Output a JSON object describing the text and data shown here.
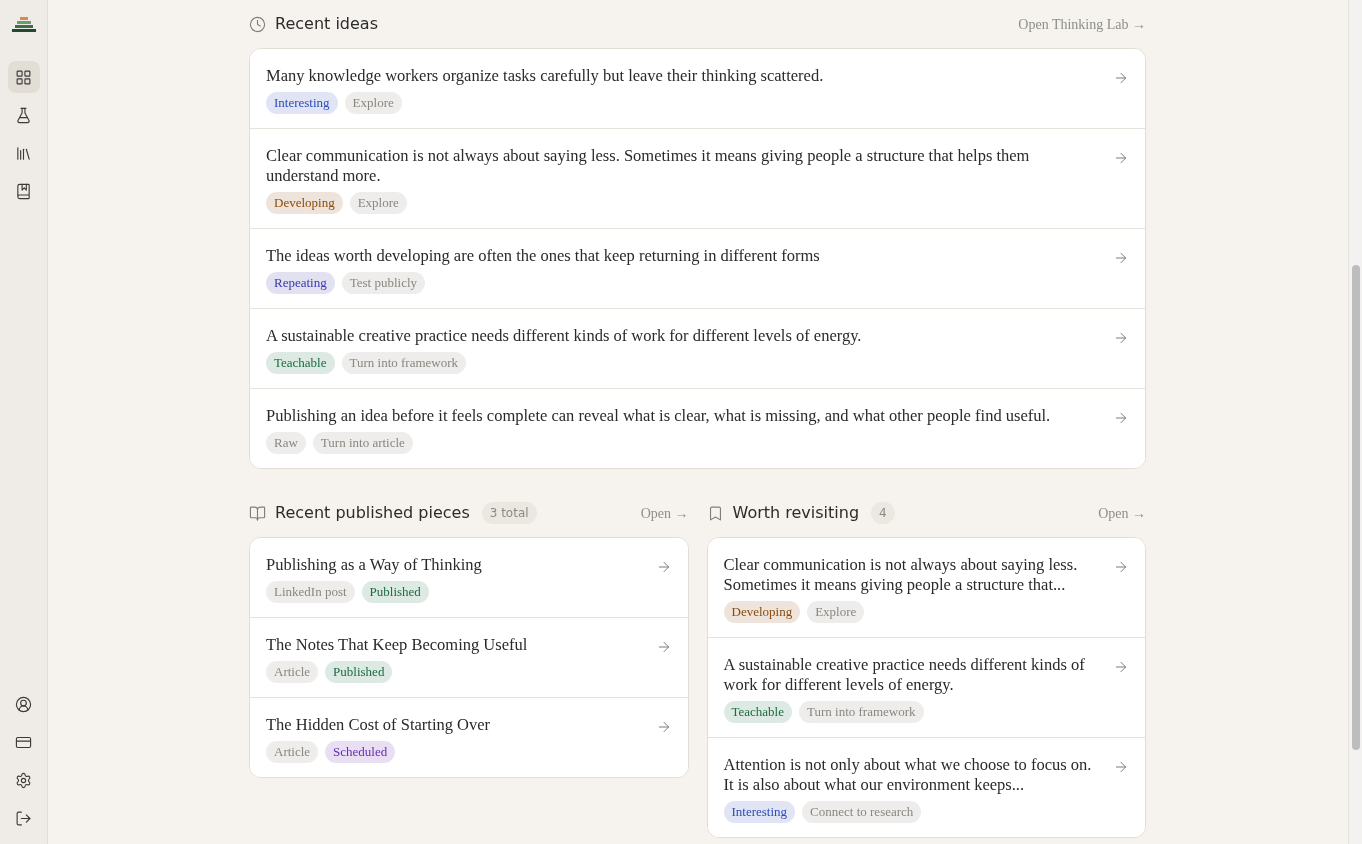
{
  "recent_ideas": {
    "title": "Recent ideas",
    "link": "Open Thinking Lab →",
    "items": [
      {
        "text": "Many knowledge workers organize tasks carefully but leave their thinking scattered.",
        "tags": [
          {
            "label": "Interesting",
            "color": "#2d4cb8"
          },
          {
            "label": "Explore",
            "color": "#8a877f"
          }
        ]
      },
      {
        "text": "Clear communication is not always about saying less. Sometimes it means giving people a structure that helps them understand more.",
        "tags": [
          {
            "label": "Developing",
            "color": "#8a4a0c"
          },
          {
            "label": "Explore",
            "color": "#8a877f"
          }
        ]
      },
      {
        "text": "The ideas worth developing are often the ones that keep returning in different forms",
        "tags": [
          {
            "label": "Repeating",
            "color": "#3a38a8"
          },
          {
            "label": "Test publicly",
            "color": "#8a877f"
          }
        ]
      },
      {
        "text": "A sustainable creative practice needs different kinds of work for different levels of energy.",
        "tags": [
          {
            "label": "Teachable",
            "color": "#1d6a40"
          },
          {
            "label": "Turn into framework",
            "color": "#8a877f"
          }
        ]
      },
      {
        "text": "Publishing an idea before it feels complete can reveal what is clear, what is missing, and what other people find useful.",
        "tags": [
          {
            "label": "Raw",
            "color": "#8a877f"
          },
          {
            "label": "Turn into article",
            "color": "#8a877f"
          }
        ]
      }
    ]
  },
  "published": {
    "title": "Recent published pieces",
    "count": "3 total",
    "link": "Open →",
    "items": [
      {
        "text": "Publishing as a Way of Thinking",
        "tags": [
          {
            "label": "LinkedIn post",
            "color": "#8a877f"
          },
          {
            "label": "Published",
            "color": "#1d6a40"
          }
        ]
      },
      {
        "text": "The Notes That Keep Becoming Useful",
        "tags": [
          {
            "label": "Article",
            "color": "#8a877f"
          },
          {
            "label": "Published",
            "color": "#1d6a40"
          }
        ]
      },
      {
        "text": "The Hidden Cost of Starting Over",
        "tags": [
          {
            "label": "Article",
            "color": "#8a877f"
          },
          {
            "label": "Scheduled",
            "color": "#6a2bb0"
          }
        ]
      }
    ]
  },
  "revisit": {
    "title": "Worth revisiting",
    "count": "4",
    "link": "Open →",
    "items": [
      {
        "text": "Clear communication is not always about saying less. Sometimes it means giving people a structure that...",
        "tags": [
          {
            "label": "Developing",
            "color": "#8a4a0c"
          },
          {
            "label": "Explore",
            "color": "#8a877f"
          }
        ]
      },
      {
        "text": "A sustainable creative practice needs different kinds of work for different levels of energy.",
        "tags": [
          {
            "label": "Teachable",
            "color": "#1d6a40"
          },
          {
            "label": "Turn into framework",
            "color": "#8a877f"
          }
        ]
      },
      {
        "text": "Attention is not only about what we choose to focus on. It is also about what our environment keeps...",
        "tags": [
          {
            "label": "Interesting",
            "color": "#2d4cb8"
          },
          {
            "label": "Connect to research",
            "color": "#8a877f"
          }
        ]
      }
    ]
  },
  "sidebar": {
    "items": [
      {
        "kind": "dashboard",
        "selected": true
      },
      {
        "kind": "lab",
        "selected": false
      },
      {
        "kind": "library",
        "selected": false
      },
      {
        "kind": "notebook",
        "selected": false
      }
    ],
    "bottom": [
      {
        "kind": "account"
      },
      {
        "kind": "billing"
      },
      {
        "kind": "settings"
      },
      {
        "kind": "logout"
      }
    ]
  }
}
